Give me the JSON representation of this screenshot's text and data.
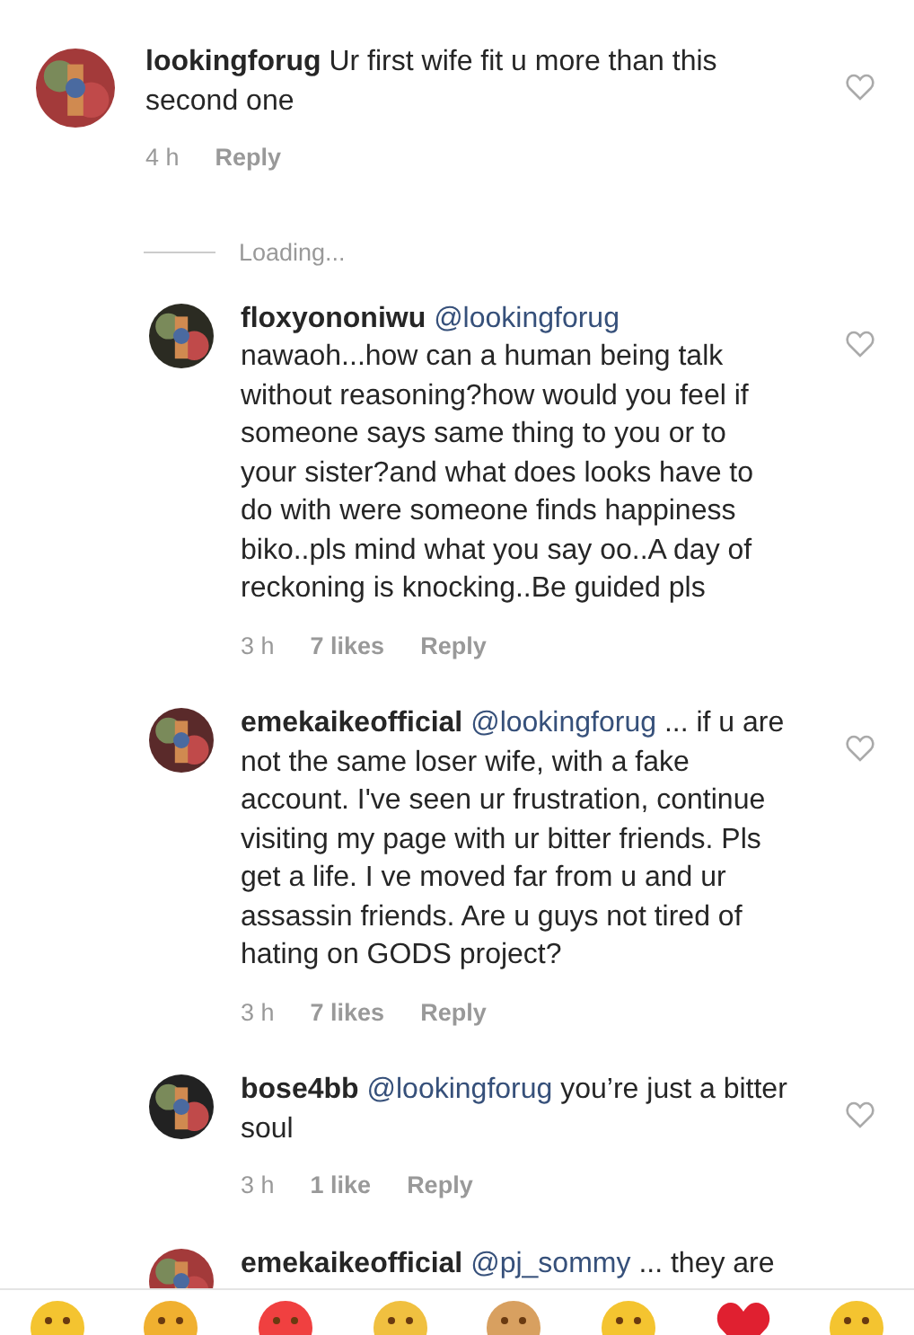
{
  "comments": [
    {
      "kind": "comment",
      "username": "lookingforug",
      "text": "Ur first wife fit u more than this second one",
      "time": "4 h",
      "reply": "Reply",
      "liked": false
    },
    {
      "kind": "loading",
      "text": "Loading..."
    },
    {
      "kind": "reply",
      "username": "floxyononiwu",
      "mention": "@lookingforug",
      "text": "nawaoh...how can a human being talk without reasoning?how would you feel if someone says same thing to you or to your sister?and what does looks have to do with were someone finds happiness biko..pls mind what you say oo..A day of reckoning is knocking..Be guided pls",
      "time": "3 h",
      "likes": "7 likes",
      "reply": "Reply",
      "liked": false
    },
    {
      "kind": "reply",
      "username": "emekaikeofficial",
      "mention": "@lookingforug",
      "text": "... if u are not the same loser wife, with a fake account. I've seen ur frustration, continue visiting my page with ur bitter friends. Pls get a life. I ve moved far from u and ur assassin friends. Are u guys not tired of hating on  GODS project?",
      "time": "3 h",
      "likes": "7 likes",
      "reply": "Reply",
      "liked": false
    },
    {
      "kind": "reply",
      "username": "bose4bb",
      "mention": "@lookingforug",
      "text": "you’re just a bitter soul",
      "time": "3 h",
      "likes": "1 like",
      "reply": "Reply",
      "liked": false
    },
    {
      "kind": "reply",
      "username": "emekaikeofficial",
      "mention": "@pj_sommy",
      "text": "... they are"
    }
  ],
  "emojis": [
    {
      "kind": "face"
    },
    {
      "kind": "face"
    },
    {
      "kind": "face"
    },
    {
      "kind": "face"
    },
    {
      "kind": "face"
    },
    {
      "kind": "face"
    },
    {
      "kind": "heart"
    },
    {
      "kind": "face"
    }
  ]
}
